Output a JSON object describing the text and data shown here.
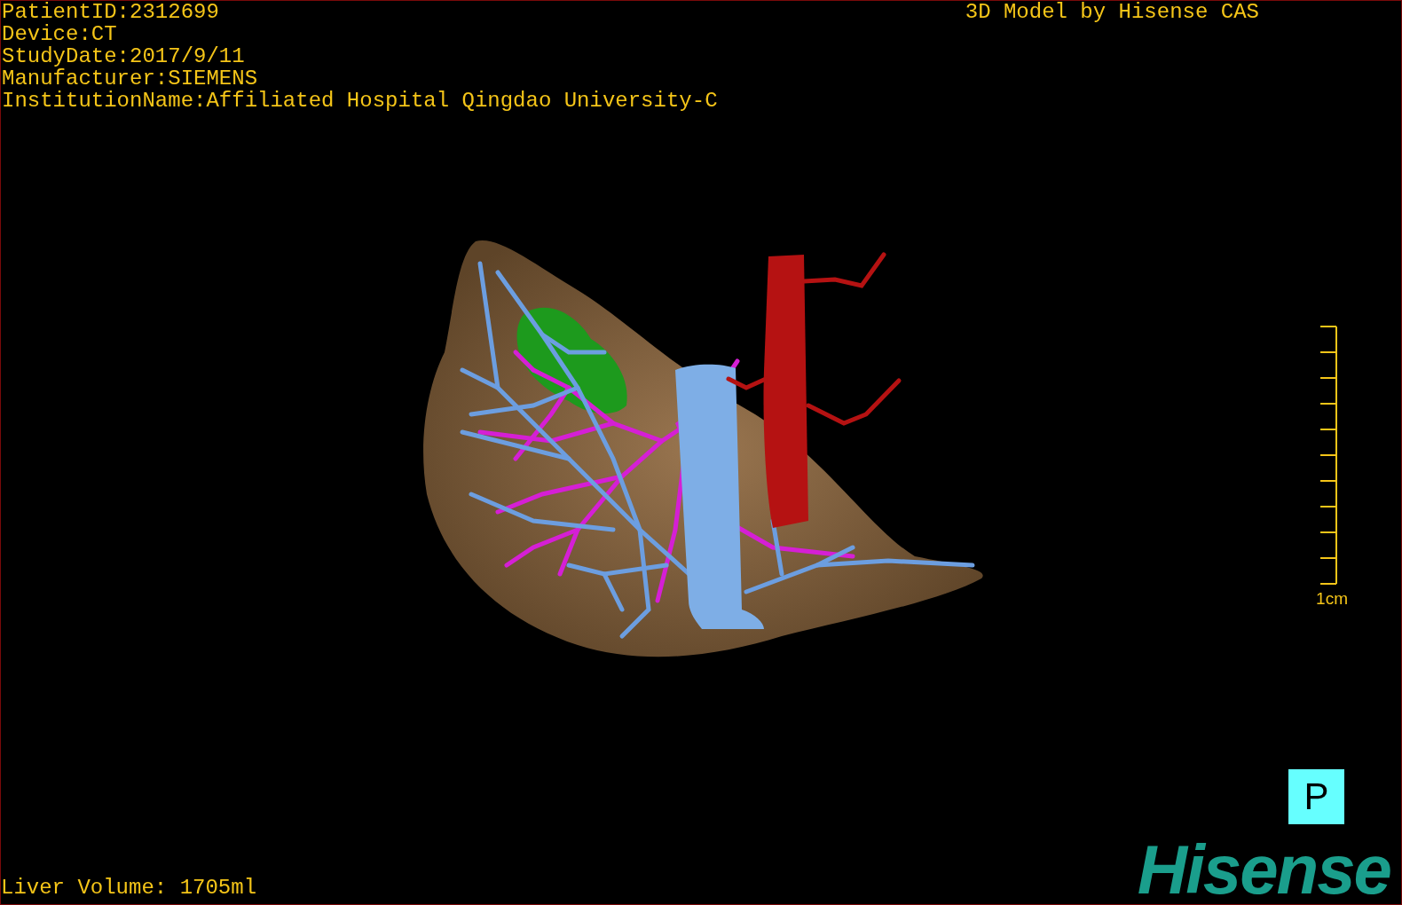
{
  "patient_info": [
    "PatientID:2312699",
    "Device:CT",
    "StudyDate:2017/9/11",
    "Manufacturer:SIEMENS",
    "InstitutionName:Affiliated Hospital Qingdao University-C"
  ],
  "title": "3D Model by Hisense CAS",
  "scale_bar": {
    "label": "1cm"
  },
  "orientation_marker": "P",
  "liver_volume": "Liver Volume: 1705ml",
  "logo": "Hisense"
}
